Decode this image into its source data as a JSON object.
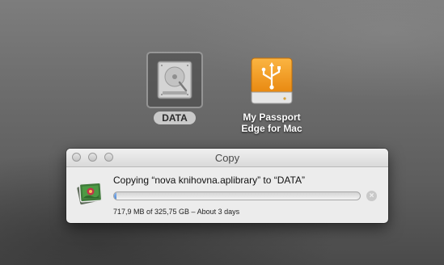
{
  "desktop": {
    "icons": [
      {
        "label": "DATA",
        "selected": true,
        "icon": "hard-drive-icon"
      },
      {
        "label_lines": [
          "My Passport",
          "Edge for Mac"
        ],
        "selected": false,
        "icon": "usb-drive-icon"
      }
    ]
  },
  "copy_window": {
    "title": "Copy",
    "status_text": "Copying “nova knihovna.aplibrary” to “DATA”",
    "detail_text": "717,9 MB of 325,75 GB – About 3 days",
    "progress_fraction": 0.0022,
    "icons": {
      "file": "photo-library-icon",
      "stop": "stop-icon",
      "stop_glyph": "×"
    }
  },
  "colors": {
    "usb_drive_orange": "#f39a1c",
    "progress_blue": "#4a87d6",
    "window_bg": "#ececec"
  }
}
